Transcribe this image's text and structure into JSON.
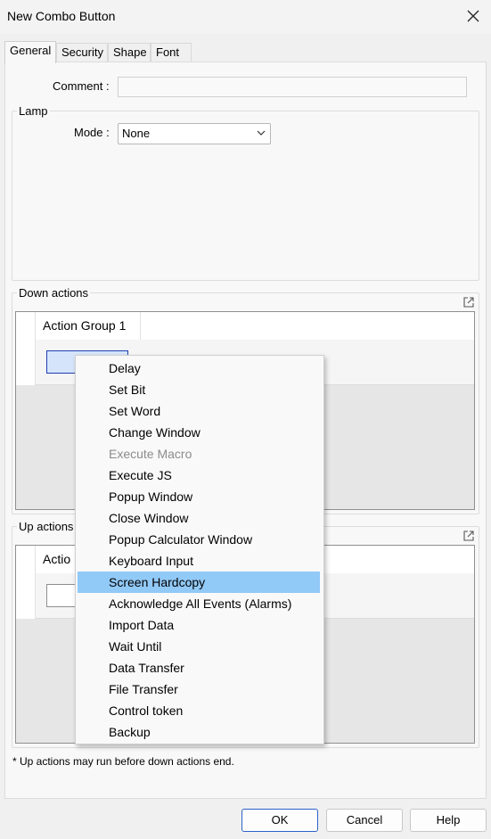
{
  "window": {
    "title": "New Combo Button"
  },
  "tabs": [
    {
      "label": "General",
      "active": true
    },
    {
      "label": "Security",
      "active": false
    },
    {
      "label": "Shape",
      "active": false
    },
    {
      "label": "Font",
      "active": false
    }
  ],
  "general": {
    "comment_label": "Comment :",
    "comment_value": "",
    "lamp": {
      "title": "Lamp",
      "mode_label": "Mode :",
      "mode_value": "None"
    },
    "down_actions": {
      "title": "Down actions",
      "group_tab": "Action Group 1"
    },
    "up_actions": {
      "title": "Up actions",
      "group_tab": "Actio"
    },
    "note": "* Up actions may run before down actions end."
  },
  "buttons": {
    "ok": "OK",
    "cancel": "Cancel",
    "help": "Help"
  },
  "context_menu": {
    "items": [
      {
        "label": "Delay",
        "disabled": false
      },
      {
        "label": "Set Bit",
        "disabled": false
      },
      {
        "label": "Set Word",
        "disabled": false
      },
      {
        "label": "Change Window",
        "disabled": false
      },
      {
        "label": "Execute Macro",
        "disabled": true
      },
      {
        "label": "Execute JS",
        "disabled": false
      },
      {
        "label": "Popup Window",
        "disabled": false
      },
      {
        "label": "Close Window",
        "disabled": false
      },
      {
        "label": "Popup Calculator Window",
        "disabled": false
      },
      {
        "label": "Keyboard Input",
        "disabled": false
      },
      {
        "label": "Screen Hardcopy",
        "disabled": false,
        "highlighted": true
      },
      {
        "label": "Acknowledge All Events (Alarms)",
        "disabled": false
      },
      {
        "label": "Import Data",
        "disabled": false
      },
      {
        "label": "Wait Until",
        "disabled": false
      },
      {
        "label": "Data Transfer",
        "disabled": false
      },
      {
        "label": "File Transfer",
        "disabled": false
      },
      {
        "label": "Control token",
        "disabled": false
      },
      {
        "label": "Backup",
        "disabled": false
      }
    ]
  },
  "colors": {
    "highlight": "#91c9f7",
    "primary_border": "#2b62c8",
    "selected_slot": "#d6e4fb"
  },
  "icons": [
    "close-icon",
    "chevron-down-icon",
    "popout-icon"
  ]
}
